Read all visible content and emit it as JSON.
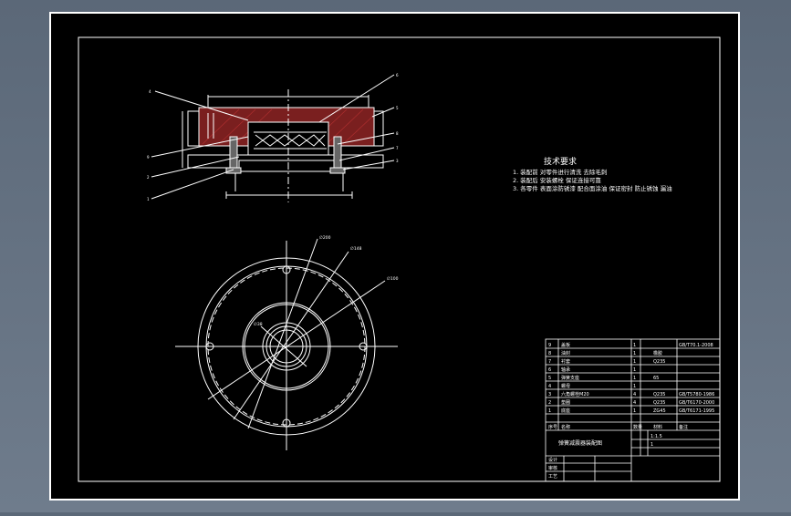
{
  "drawing": {
    "tech_req_title": "技术要求",
    "tech_req_lines": [
      "1. 装配前 对零件进行清洗 去除毛刺",
      "2. 装配后 安装螺栓 保证连接可靠",
      "3. 各零件 表面涂防锈漆 配合面涂油 保证密封 防止锈蚀 漏油"
    ],
    "top_view": {
      "label_dims": [
        "∅200",
        "∅148",
        "∅100"
      ],
      "label_small": "∅38"
    }
  },
  "title_block": {
    "rows": [
      {
        "no": "9",
        "name": "盖板",
        "qty": "1",
        "mat": "",
        "std": "GB/T70.1-2008"
      },
      {
        "no": "8",
        "name": "油封",
        "qty": "1",
        "mat": "橡胶",
        "std": ""
      },
      {
        "no": "7",
        "name": "衬套",
        "qty": "1",
        "mat": "Q235",
        "std": ""
      },
      {
        "no": "6",
        "name": "轴承",
        "qty": "1",
        "mat": "",
        "std": ""
      },
      {
        "no": "5",
        "name": "弹簧支座",
        "qty": "1",
        "mat": "65",
        "std": ""
      },
      {
        "no": "4",
        "name": "螺母",
        "qty": "1",
        "mat": "",
        "std": ""
      },
      {
        "no": "3",
        "name": "六角螺栓M20",
        "qty": "4",
        "mat": "Q235",
        "std": "GB/T5780-1986"
      },
      {
        "no": "2",
        "name": "垫圈",
        "qty": "4",
        "mat": "Q235",
        "std": "GB/T6170-2000"
      },
      {
        "no": "1",
        "name": "底座",
        "qty": "1",
        "mat": "ZG45",
        "std": "GB/T6171-1995"
      }
    ],
    "header": {
      "no": "序号",
      "name": "名称",
      "qty": "数量",
      "mat": "材料",
      "std": "备注"
    },
    "drawing_title": "弹簧减震器装配图",
    "scale": "1:1.5",
    "sheet": "1",
    "labels": [
      "设计",
      "审核",
      "工艺"
    ]
  }
}
